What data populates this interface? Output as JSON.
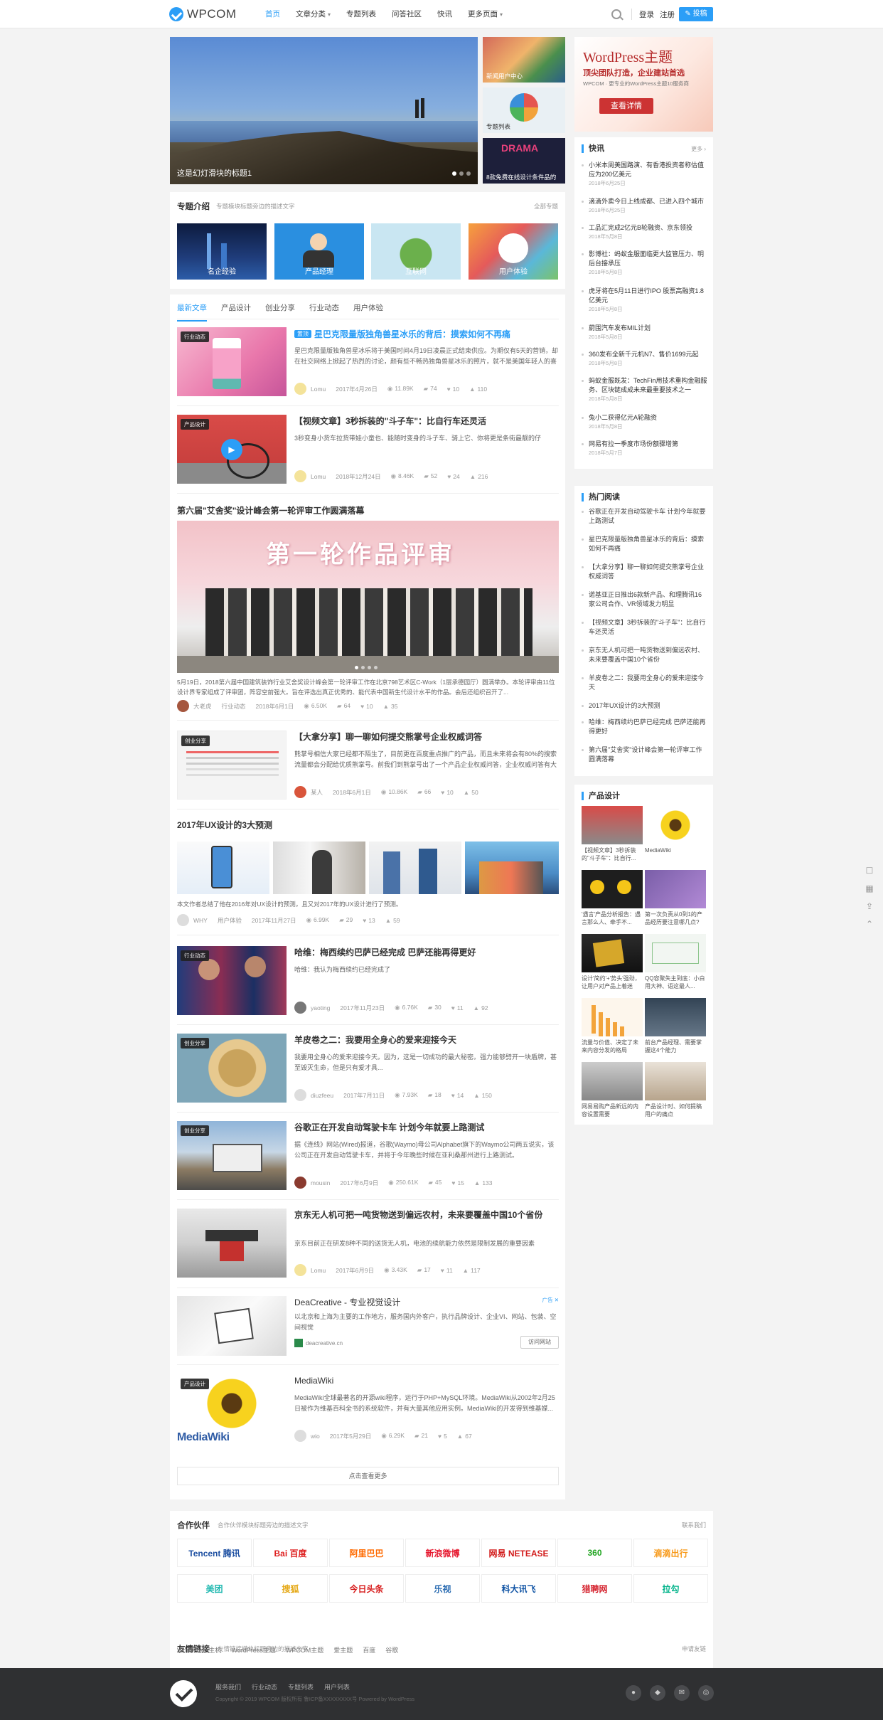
{
  "topbar": {
    "logo_text": "WPCOM",
    "nav": [
      {
        "label": "首页",
        "active": true,
        "caret": false
      },
      {
        "label": "文章分类",
        "active": false,
        "caret": true
      },
      {
        "label": "专题列表",
        "active": false,
        "caret": false
      },
      {
        "label": "问答社区",
        "active": false,
        "caret": false
      },
      {
        "label": "快讯",
        "active": false,
        "caret": false
      },
      {
        "label": "更多页面",
        "active": false,
        "caret": true
      }
    ],
    "login": "登录",
    "register": "注册",
    "post_button": "投稿"
  },
  "slider": {
    "caption": "这是幻灯滑块的标题1"
  },
  "side_thumbs": [
    {
      "label": "新闻用户中心"
    },
    {
      "label": "专题列表"
    },
    {
      "label": "8款免费在线设计条件品的"
    }
  ],
  "ad": {
    "title": "WordPress主题",
    "subtitle": "顶尖团队打造，企业建站首选",
    "desc": "WPCOM · 更专业的WordPress主题10服务商",
    "button": "查看详情"
  },
  "topics": {
    "title": "专题介绍",
    "desc": "专题模块标题旁边的描述文字",
    "more": "全部专题",
    "items": [
      "名企经验",
      "产品经理",
      "互联网",
      "用户体验"
    ]
  },
  "tabs": [
    "最新文章",
    "产品设计",
    "创业分享",
    "行业动态",
    "用户体验"
  ],
  "articles": [
    {
      "badge": "行业动态",
      "hot": "置顶",
      "title": "星巴克限量版独角兽星冰乐的背后：摸索如何不再痛",
      "excerpt": "星巴克限量版独角兽星冰乐将于美国时间4月19日凌晨正式结束供应。为期仅有5天的营销，却在社交网络上掀起了热烈的讨论，颜有些不畅热独角兽星冰乐的照片，就不是美国年轻人的喜欢...",
      "author": "Lomu",
      "date": "2017年4月26日",
      "views": "11.89K",
      "comments": "74",
      "shares": "10",
      "likes": "110"
    },
    {
      "badge": "产品设计",
      "hot": "",
      "title": "【视频文章】3秒拆装的\"斗子车\"：比自行车还灵活",
      "excerpt": "3秒变身小货车拉货带娃小童也、能随时变身的斗子车、骑上它、你将更是条街最靓的仔",
      "author": "Lomu",
      "date": "2018年12月24日",
      "views": "8.46K",
      "comments": "52",
      "shares": "24",
      "likes": "216"
    }
  ],
  "gallery_article": {
    "title": "第六届\"艾舍奖\"设计峰会第一轮评审工作圆满落幕",
    "banner": "第一轮作品评审",
    "excerpt": "5月19日，2018第六届中国建筑装饰行业艾舍奖设计峰会第一轮评审工作在北京798艺术区C-Work（1层承德园厅）圆满举办。本轮评审由11位设计界专家组成了评审团，阵容空前强大。旨在评选出真正优秀的、能代表中国新生代设计水平的作品。会后还组织召开了...",
    "author": "大老虎",
    "category": "行业动态",
    "date": "2018年6月1日",
    "views": "6.50K",
    "comments": "64",
    "shares": "10",
    "likes": "35"
  },
  "articles2": [
    {
      "badge": "创业分享",
      "title": "【大拿分享】聊一聊如何提交熊掌号企业权威词答",
      "excerpt": "熊掌号相信大家已经都不陌生了，目前更在百度重点推广的产品，而且未来将会有80%的搜索流量都会分配给优质熊掌号。前我们到熊掌号出了一个产品企业权威问答，企业权威问答有大家...",
      "author": "某人",
      "date": "2018年6月1日",
      "views": "10.86K",
      "comments": "66",
      "shares": "10",
      "likes": "50"
    }
  ],
  "ux_article": {
    "title": "2017年UX设计的3大预测",
    "excerpt": "本文作者总结了他在2016年对UX设计的预测，且又对2017年的UX设计进行了预测。",
    "author": "WHY",
    "category": "用户体验",
    "date": "2017年11月27日",
    "views": "6.99K",
    "comments": "29",
    "shares": "13",
    "likes": "59"
  },
  "articles3": [
    {
      "badge": "行业动态",
      "title": "哈维：梅西续约巴萨已经完成 巴萨还能再得更好",
      "excerpt": "哈维：我认为梅西续约已经完成了",
      "author": "yaoting",
      "date": "2017年11月23日",
      "views": "6.76K",
      "comments": "30",
      "shares": "11",
      "likes": "92"
    },
    {
      "badge": "创业分享",
      "title": "羊皮卷之二：我要用全身心的爱来迎接今天",
      "excerpt": "我要用全身心的爱来迎接今天。因为，这是一切成功的最大秘密。强力能够劈开一块盾牌，甚至毁灭生命，但是只有爱才具...",
      "author": "diuzfeeu",
      "date": "2017年7月11日",
      "views": "7.93K",
      "comments": "18",
      "shares": "14",
      "likes": "150"
    },
    {
      "badge": "创业分享",
      "title": "谷歌正在开发自动驾驶卡车 计划今年就要上路测试",
      "excerpt": "据《连线》网站(Wired)报道，谷歌(Waymo)母公司Alphabet旗下的Waymo公司两五说实，该公司正在开发自动驾驶卡车，并将于今年晚些时候在亚利桑那州进行上路测试。",
      "author": "mousin",
      "date": "2017年6月9日",
      "views": "250.61K",
      "comments": "45",
      "shares": "15",
      "likes": "133"
    },
    {
      "badge": "",
      "title": "京东无人机可把一吨货物送到偏远农村，未来要覆盖中国10个省份",
      "excerpt": "京东目前正在研发8种不同的送货无人机，电池的续航能力依然是限制发展的重要因素",
      "author": "Lomu",
      "date": "2017年6月9日",
      "views": "3.43K",
      "comments": "17",
      "shares": "11",
      "likes": "117"
    }
  ],
  "sponsored": {
    "title": "DeaCreative - 专业视觉设计",
    "excerpt": "以北京和上海为主要的工作地方，服务国内外客户，执行品牌设计、企业VI、网站、包装、空间视觉",
    "site": "deacreative.cn",
    "button": "访问网站",
    "tag": "广告"
  },
  "mediawiki": {
    "badge": "产品设计",
    "title": "MediaWiki",
    "excerpt": "MediaWiki全球最著名的开源wiki程序，运行于PHP+MySQL环境。MediaWiki从2002年2月25日被作为维基百科全书的系统软件，并有大量其他应用实例。MediaWiki的开发得到维基媒...",
    "author": "wio",
    "date": "2017年5月29日",
    "views": "6.29K",
    "comments": "21",
    "shares": "5",
    "likes": "67"
  },
  "load_more": "点击查看更多",
  "flash": {
    "title": "快讯",
    "more": "更多",
    "items": [
      {
        "text": "小米本周美国路演、有香港投资者称估值应为200亿美元",
        "date": "2018年6月25日"
      },
      {
        "text": "滴滴外卖今日上线成都、已进入四个城市",
        "date": "2018年6月25日"
      },
      {
        "text": "工品汇完成2亿元B轮融资、京东领投",
        "date": "2018年5月8日"
      },
      {
        "text": "影博社：蚂蚁金服面临更大监管压力、明后台接承压",
        "date": "2018年5月8日"
      },
      {
        "text": "虎牙将在5月11日进行IPO 股票高融资1.8亿美元",
        "date": "2018年5月8日"
      },
      {
        "text": "蔚围汽车发布MIL计划",
        "date": "2018年5月8日"
      },
      {
        "text": "360发布全新千元机N7、售价1699元起",
        "date": "2018年5月8日"
      },
      {
        "text": "蚂蚁金服既发：TechFin用技术重构金融服务、区块链成成未来最重要技术之一",
        "date": "2018年5月8日"
      },
      {
        "text": "兔小二获得亿元A轮融资",
        "date": "2018年5月8日"
      },
      {
        "text": "网易有拉一季度市场份额骤增第",
        "date": "2018年5月7日"
      }
    ]
  },
  "hot": {
    "title": "热门阅读",
    "items": [
      "谷歌正在开发自动驾驶卡车 计划今年就要上路测试",
      "星巴克限量版独角兽星冰乐的背后：摸索如何不再痛",
      "【大拿分享】聊一聊如何提交熊掌号企业权威词答",
      "诺基亚正日推出6款新产品、和理腾讯16家公司合作、VR领域发力明显",
      "【视频文章】3秒拆装的\"斗子车\"：比自行车还灵活",
      "京东无人机可把一吨货物送到偏远农村、未来要覆盖中国10个省份",
      "羊皮卷之二：我要用全身心的爱来迎接今天",
      "2017年UX设计的3大预测",
      "哈维：梅西续约巴萨已经完成 巴萨还能再得更好",
      "第六届\"艾舍奖\"设计峰会第一轮评审工作圆满落幕"
    ]
  },
  "product": {
    "title": "产品设计",
    "items": [
      "【视频文章】3秒拆装的\"斗子车\"：比自行...",
      "MediaWiki",
      "'遇言'产品分析报告：遇言那么人、牵手不...",
      "第一次负责从0到1的产品经历要注意哪几点?",
      "设计'简约'+'势头'强劲，让用户对产品上着迷",
      "QQ容聚失主到底：小白用大神、语这最人...",
      "流量与价值、决定了未来内容分发的格局",
      "前台产品经理、需要掌握这4个能力",
      "网易易购产品新远的内容设置需要",
      "产品设计时、如何提稿用户的痛点"
    ]
  },
  "partners": {
    "title": "合作伙伴",
    "desc": "合作伙伴模块标题旁边的描述文字",
    "more": "联系我们",
    "logos": [
      {
        "name": "Tencent 腾讯",
        "color": "#1e50a2"
      },
      {
        "name": "Bai 百度",
        "color": "#de1e1e"
      },
      {
        "name": "阿里巴巴",
        "color": "#ff6a00"
      },
      {
        "name": "新浪微博",
        "color": "#e6162d"
      },
      {
        "name": "网易 NETEASE",
        "color": "#d21b1b"
      },
      {
        "name": "360",
        "color": "#22a622"
      },
      {
        "name": "滴滴出行",
        "color": "#f79a1b"
      },
      {
        "name": "美团",
        "color": "#20b8b0"
      },
      {
        "name": "搜狐",
        "color": "#e5a815"
      },
      {
        "name": "今日头条",
        "color": "#d71c1c"
      },
      {
        "name": "乐视",
        "color": "#2b6cb2"
      },
      {
        "name": "科大讯飞",
        "color": "#1255a5"
      },
      {
        "name": "猎聘网",
        "color": "#d5232e"
      },
      {
        "name": "拉勾",
        "color": "#00b38a"
      }
    ]
  },
  "friend_links": {
    "title": "友情链接",
    "desc": "友情链接模块标题旁边的描述文字",
    "more": "申请友链",
    "items": [
      "WordPress主机",
      "WordPress主题",
      "WPCOM主题",
      "爱主题",
      "百度",
      "谷歌"
    ]
  },
  "footer": {
    "links": [
      "服务我们",
      "行业动态",
      "专题列表",
      "用户列表"
    ],
    "copyright": "Copyright © 2019 WPCOM 版权所有 鲁ICP备XXXXXXXX号 Powered by WordPress"
  },
  "colors": {
    "accent": "#2b9ef7",
    "footer_bg": "#2f3032"
  }
}
